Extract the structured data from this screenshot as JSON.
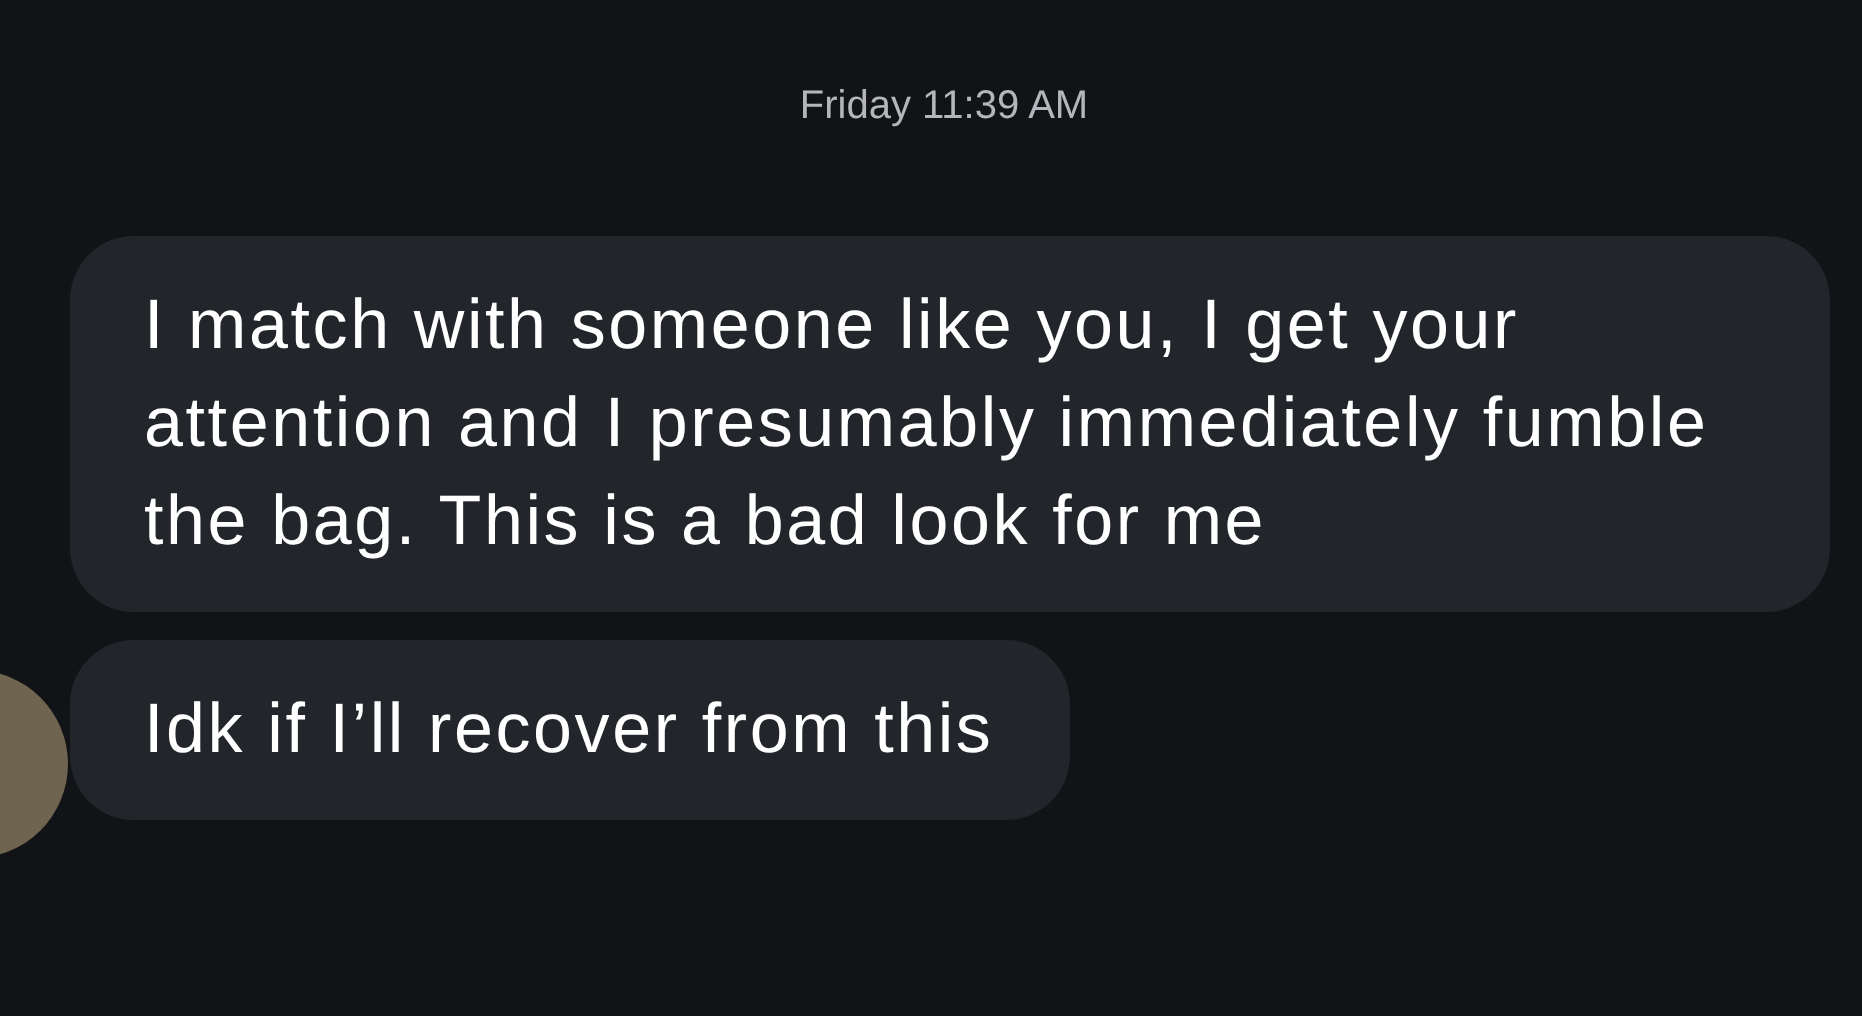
{
  "timestamp": "Friday 11:39 AM",
  "messages": [
    {
      "text": "I match with someone like you, I get your attention and I presumably immediately fumble the bag. This is a bad look for me",
      "avatar": false
    },
    {
      "text": "Idk if I’ll recover from this",
      "avatar": true
    }
  ]
}
